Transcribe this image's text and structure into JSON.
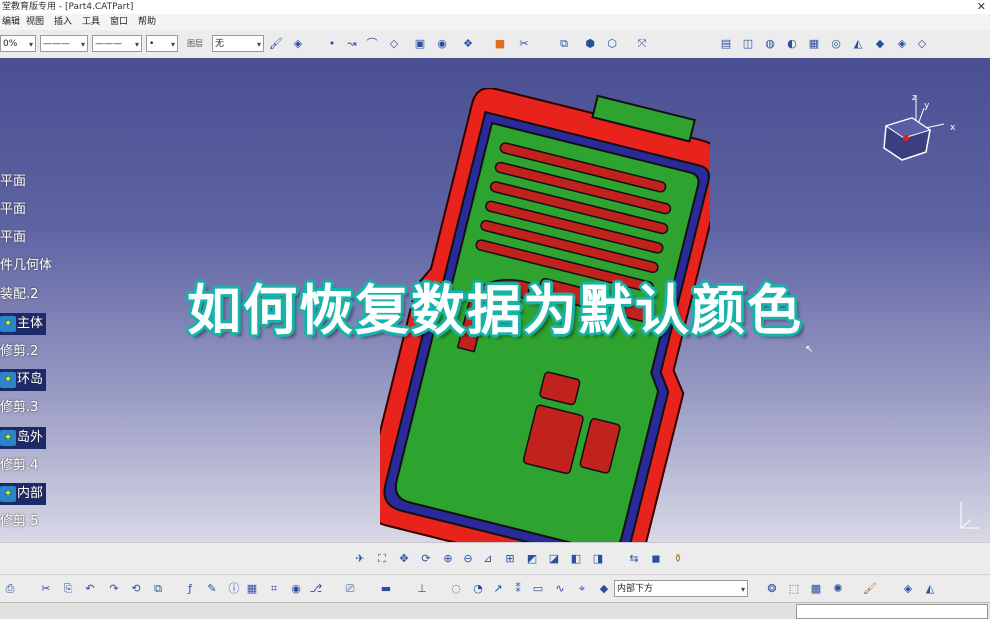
{
  "window": {
    "title": "堂教育版专用 - [Part4.CATPart]",
    "close_glyph": "✕"
  },
  "menu": [
    "编辑",
    "视图",
    "插入",
    "工具",
    "窗口",
    "帮助"
  ],
  "toolbar_top": {
    "zoom_value": "0%",
    "line_type": "———",
    "line_weight": "———",
    "point_style": "•",
    "layer_label": "图层",
    "layer_value": "无"
  },
  "tree": {
    "items": [
      {
        "label": "平面",
        "icon": "plane-icon",
        "selected": false
      },
      {
        "label": "平面",
        "icon": "plane-icon",
        "selected": false
      },
      {
        "label": "平面",
        "icon": "plane-icon",
        "selected": false
      },
      {
        "label": "件几何体",
        "icon": "body-icon",
        "selected": false
      },
      {
        "label": "装配.2",
        "icon": "assembly-icon",
        "selected": false
      },
      {
        "label": "主体",
        "icon": "surface-icon",
        "selected": true
      },
      {
        "label": "修剪.2",
        "icon": "trim-icon",
        "selected": false
      },
      {
        "label": "环岛",
        "icon": "surface-icon",
        "selected": true
      },
      {
        "label": "修剪.3",
        "icon": "trim-icon",
        "selected": false
      },
      {
        "label": "岛外",
        "icon": "surface-icon",
        "selected": true
      },
      {
        "label": "修剪.4",
        "icon": "trim-icon",
        "selected": false
      },
      {
        "label": "内部",
        "icon": "surface-icon",
        "selected": true
      },
      {
        "label": "修剪.5",
        "icon": "trim-icon",
        "selected": false
      }
    ]
  },
  "overlay": {
    "title": "如何恢复数据为默认颜色"
  },
  "compass": {
    "x_label": "x",
    "y_label": "y",
    "z_label": "z"
  },
  "toolbar_bottom": {
    "layer_filter_value": "内部下方"
  },
  "colors": {
    "viewport_top": "#4a4f92",
    "viewport_bottom": "#d8d8e6",
    "mat_outer": "#e8231c",
    "mat_inner": "#2fa32f",
    "mat_border": "#2a2a9a",
    "overlay_stroke": "#17b3a8"
  }
}
